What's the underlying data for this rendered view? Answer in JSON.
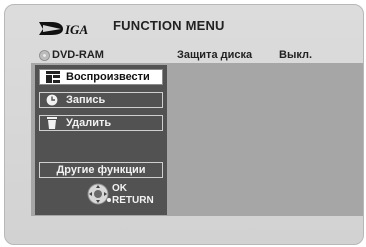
{
  "header": {
    "brand": "DIGA",
    "title": "FUNCTION MENU"
  },
  "info": {
    "drive": "DVD-RAM",
    "protection_label": "Защита диска",
    "protection_value": "Выкл."
  },
  "menu": {
    "items": [
      {
        "label": "Воспроизвести",
        "icon": "play-icon",
        "selected": true
      },
      {
        "label": "Запись",
        "icon": "clock-icon",
        "selected": false
      },
      {
        "label": "Удалить",
        "icon": "trash-icon",
        "selected": false
      }
    ],
    "other": "Другие функции",
    "ok": "OK",
    "return": "RETURN"
  },
  "colors": {
    "frame": "#d6d6d6",
    "panel": "#a6a6a6",
    "menu": "#525252",
    "selected": "#ffffff"
  }
}
